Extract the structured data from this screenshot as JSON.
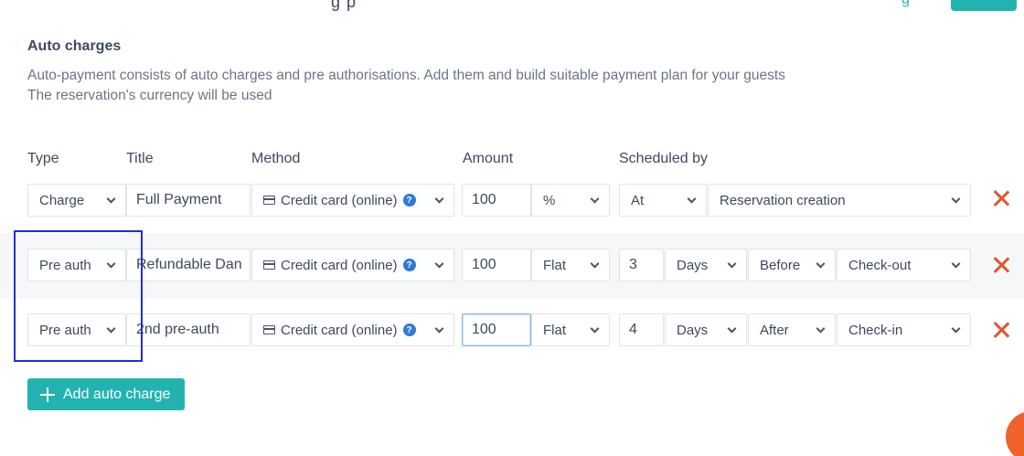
{
  "header": {
    "title_fragment": "g p",
    "link_fragment": "g"
  },
  "section": {
    "title": "Auto charges",
    "description_line1": "Auto-payment consists of auto charges and pre authorisations. Add them and build suitable payment plan for your guests",
    "description_line2": "The reservation's currency will be used"
  },
  "columns": {
    "type": "Type",
    "title": "Title",
    "method": "Method",
    "amount": "Amount",
    "scheduled_by": "Scheduled by"
  },
  "rows": [
    {
      "type": "Charge",
      "title": "Full Payment",
      "method": "Credit card (online)",
      "amount": "100",
      "unit": "%",
      "schedule_when": "At",
      "schedule_event": "Reservation creation"
    },
    {
      "type": "Pre auth",
      "title": "Refundable Dan",
      "method": "Credit card (online)",
      "amount": "100",
      "unit": "Flat",
      "schedule_count": "3",
      "schedule_period": "Days",
      "schedule_relation": "Before",
      "schedule_event": "Check-out"
    },
    {
      "type": "Pre auth",
      "title": "2nd pre-auth",
      "method": "Credit card (online)",
      "amount": "100",
      "unit": "Flat",
      "schedule_count": "4",
      "schedule_period": "Days",
      "schedule_relation": "After",
      "schedule_event": "Check-in"
    }
  ],
  "actions": {
    "add_label": "Add auto charge"
  },
  "colors": {
    "accent": "#22b3b0",
    "remove": "#e0552f",
    "highlight": "#1f2fd6",
    "help": "#2f7bd6"
  },
  "icons": {
    "card": "credit-card-icon",
    "help": "help-icon",
    "remove": "close-icon",
    "add": "plus-icon",
    "dropdown": "chevron-down-icon"
  }
}
